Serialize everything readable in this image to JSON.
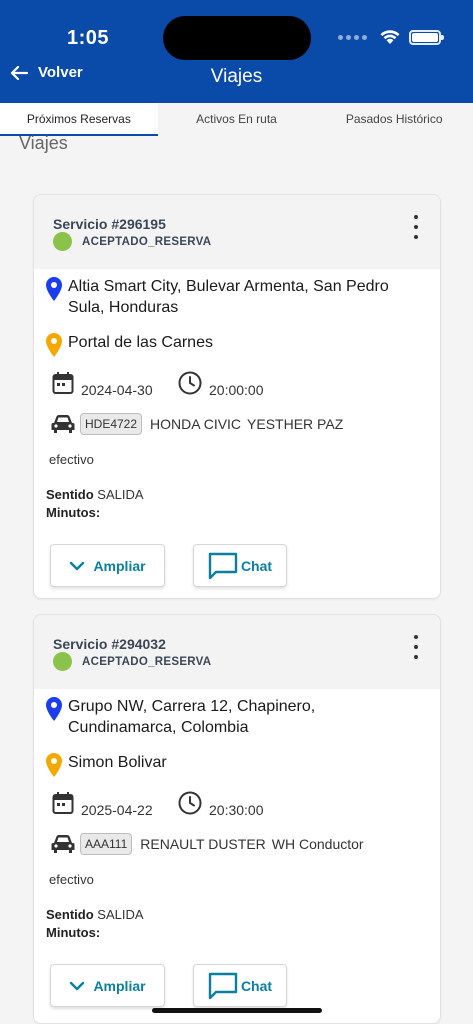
{
  "status_bar": {
    "time": "1:05"
  },
  "nav": {
    "back_label": "Volver",
    "title": "Viajes"
  },
  "tabs": [
    {
      "label": "Próximos Reservas",
      "active": true
    },
    {
      "label": "Activos En ruta",
      "active": false
    },
    {
      "label": "Pasados Histórico",
      "active": false
    }
  ],
  "section_title": "Viajes",
  "colors": {
    "header": "#0a4aa8",
    "status_ok": "#8bc34a",
    "origin_pin": "#1a3df0",
    "dest_pin": "#f5a800",
    "action": "#0a7f9f"
  },
  "cards": [
    {
      "service": "Servicio #296195",
      "status": "ACEPTADO_RESERVA",
      "origin": "Altia Smart City, Bulevar Armenta, San Pedro Sula, Honduras",
      "destination": "Portal de las Carnes",
      "date": "2024-04-30",
      "time": "20:00:00",
      "plate": "HDE4722",
      "vehicle": "HONDA CIVIC",
      "driver": "YESTHER PAZ",
      "payment": "efectivo",
      "sentido_label": "Sentido",
      "sentido_value": "SALIDA",
      "minutos_label": "Minutos:",
      "expand_label": "Ampliar",
      "chat_label": "Chat"
    },
    {
      "service": "Servicio #294032",
      "status": "ACEPTADO_RESERVA",
      "origin": "Grupo NW, Carrera 12, Chapinero, Cundinamarca, Colombia",
      "destination": "Simon Bolivar",
      "date": "2025-04-22",
      "time": "20:30:00",
      "plate": "AAA111",
      "vehicle": "RENAULT DUSTER",
      "driver": "WH Conductor",
      "payment": "efectivo",
      "sentido_label": "Sentido",
      "sentido_value": "SALIDA",
      "minutos_label": "Minutos:",
      "expand_label": "Ampliar",
      "chat_label": "Chat"
    }
  ]
}
